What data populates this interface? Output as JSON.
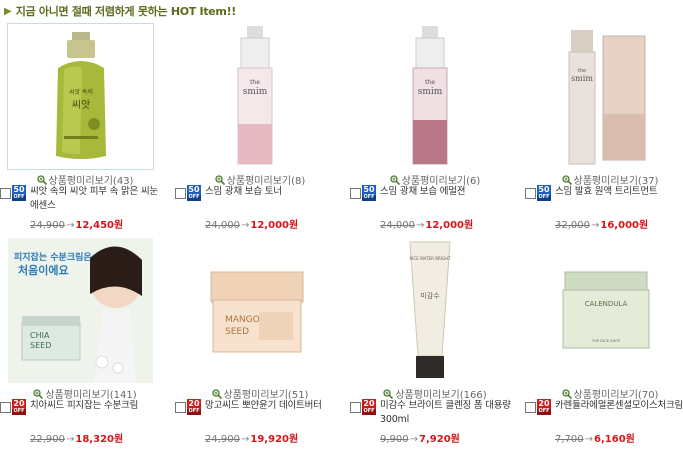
{
  "header": {
    "bullet": "▶",
    "title": "지금 아니면 절때 저렴하게 못하는 HOT Item!!"
  },
  "review_icon": "magnifier-plus-icon",
  "products": [
    {
      "name": "씨앗 속의 씨앗 피부 속 맑은 씨눈에센스",
      "review": "상품평미리보기(43)",
      "badge": "",
      "old_price": "24,900",
      "arrow": "→",
      "new_price": "12,450원",
      "selected": true
    },
    {
      "name": "스밈 광채 보습 토너",
      "review": "상품평미리보기(8)",
      "badge": "50",
      "old_price": "24,000",
      "arrow": "→",
      "new_price": "12,000원"
    },
    {
      "name": "스밈 광채 보습 에멀젼",
      "review": "상품평미리보기(6)",
      "badge": "50",
      "old_price": "24,000",
      "arrow": "→",
      "new_price": "12,000원"
    },
    {
      "name": "스밈 발효 원액 트리트먼트",
      "review": "상품평미리보기(37)",
      "badge": "50",
      "old_price": "32,000",
      "arrow": "→",
      "new_price": "16,000원"
    },
    {
      "name": "치아씨드 피지잡는 수분크림",
      "review": "상품평미리보기(141)",
      "badge": "20",
      "old_price": "22,900",
      "arrow": "→",
      "new_price": "18,320원"
    },
    {
      "name": "망고씨드 뽀얀윤기 데이트버터",
      "review": "상품평미리보기(51)",
      "badge": "20",
      "old_price": "24,900",
      "arrow": "→",
      "new_price": "19,920원"
    },
    {
      "name": "미감수 브라이트 클렌징 폼 대용량 300ml",
      "review": "상품평미리보기(166)",
      "badge": "20",
      "old_price": "9,900",
      "arrow": "→",
      "new_price": "7,920원"
    },
    {
      "name": "카렌듈라에멀론센셜모이스처크림",
      "review": "상품평미리보기(70)",
      "badge": "20",
      "old_price": "7,700",
      "arrow": "→",
      "new_price": "6,160원"
    }
  ],
  "badge_off": "OFF",
  "images": {
    "p1": {
      "label_lines": [
        "씨앗 속의",
        "씨앗"
      ]
    },
    "p2": {
      "label_lines": [
        "the",
        "smim"
      ]
    },
    "p3": {
      "label_lines": [
        "the",
        "smim"
      ]
    },
    "p4": {
      "label_lines": [
        "the",
        "smim"
      ]
    },
    "p5": {
      "headline": [
        "피지잡는 수분크림은",
        "처음이에요"
      ],
      "jar_lines": [
        "CHIA",
        "SEED"
      ]
    },
    "p6": {
      "jar_lines": [
        "MANGO",
        "SEED"
      ]
    },
    "p7": {
      "tube_lines": [
        "RICE WATER BRIGHT",
        "미감수"
      ]
    },
    "p8": {
      "jar_lines": [
        "CALENDULA"
      ],
      "brand": "THE FACE SHOP"
    }
  }
}
